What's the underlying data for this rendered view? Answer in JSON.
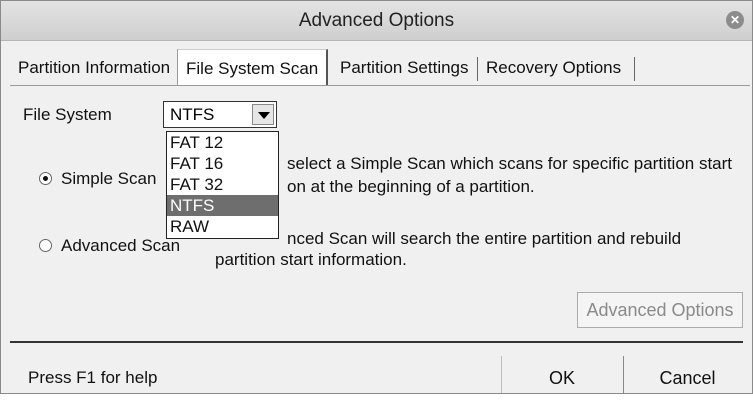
{
  "window": {
    "title": "Advanced Options",
    "close_glyph": "✕"
  },
  "tabs": [
    {
      "label": "Partition Information"
    },
    {
      "label": "File System Scan"
    },
    {
      "label": "Partition Settings"
    },
    {
      "label": "Recovery Options"
    }
  ],
  "file_system": {
    "label": "File System",
    "selected": "NTFS",
    "options": [
      "FAT 12",
      "FAT 16",
      "FAT 32",
      "NTFS",
      "RAW"
    ]
  },
  "scan": {
    "simple_label": "Simple Scan",
    "simple_desc_line1": "select a Simple Scan which scans for specific partition start",
    "simple_desc_line2": "on at the beginning of a partition.",
    "advanced_label": "Advanced Scan",
    "advanced_desc_line1": "nced Scan will search the entire partition and rebuild",
    "advanced_desc_line2": "partition start information."
  },
  "buttons": {
    "advanced_options": "Advanced Options",
    "ok": "OK",
    "cancel": "Cancel"
  },
  "status": "Press F1 for help"
}
